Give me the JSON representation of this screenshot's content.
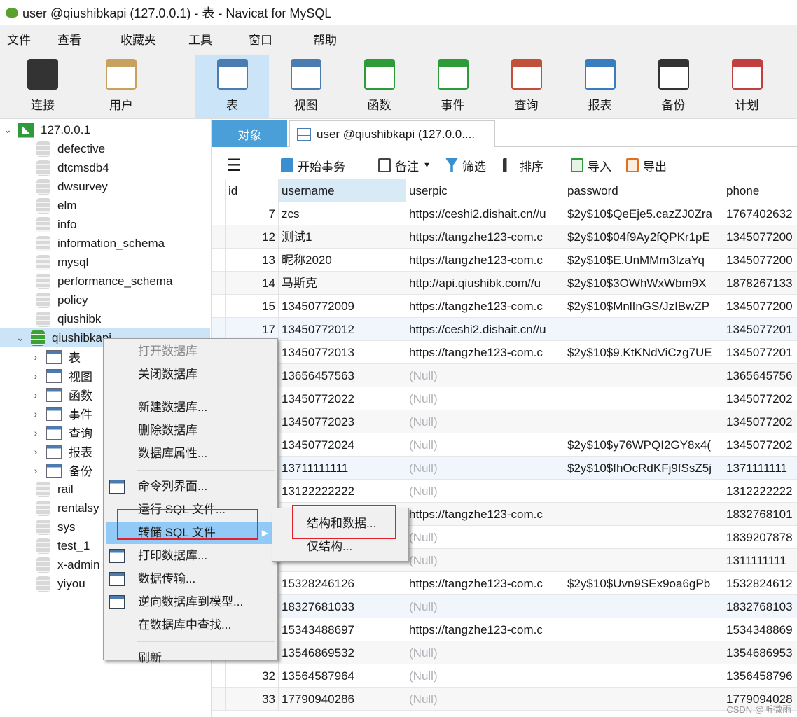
{
  "window": {
    "title": "user @qiushibkapi (127.0.0.1) - 表 - Navicat for MySQL"
  },
  "menubar": [
    "文件",
    "查看",
    "收藏夹",
    "工具",
    "窗口",
    "帮助"
  ],
  "toolbar": [
    {
      "label": "连接",
      "icon": "connection-icon"
    },
    {
      "label": "用户",
      "icon": "user-icon"
    },
    {
      "label": "表",
      "icon": "table-icon",
      "active": true
    },
    {
      "label": "视图",
      "icon": "view-icon"
    },
    {
      "label": "函数",
      "icon": "function-icon"
    },
    {
      "label": "事件",
      "icon": "event-icon"
    },
    {
      "label": "查询",
      "icon": "query-icon"
    },
    {
      "label": "报表",
      "icon": "report-icon"
    },
    {
      "label": "备份",
      "icon": "backup-icon"
    },
    {
      "label": "计划",
      "icon": "schedule-icon"
    }
  ],
  "sidebar": {
    "connection": "127.0.0.1",
    "databases": [
      "defective",
      "dtcmsdb4",
      "dwsurvey",
      "elm",
      "info",
      "information_schema",
      "mysql",
      "performance_schema",
      "policy",
      "qiushibk",
      "qiushibkapi",
      "rail",
      "rentalsy",
      "sys",
      "test_1",
      "x-admin",
      "yiyou"
    ],
    "selected": "qiushibkapi",
    "children": [
      {
        "label": "表",
        "icon": "table-icon"
      },
      {
        "label": "视图",
        "icon": "view-icon"
      },
      {
        "label": "函数",
        "icon": "function-icon"
      },
      {
        "label": "事件",
        "icon": "event-icon"
      },
      {
        "label": "查询",
        "icon": "query-icon"
      },
      {
        "label": "报表",
        "icon": "report-icon"
      },
      {
        "label": "备份",
        "icon": "backup-icon"
      }
    ]
  },
  "tabs": {
    "objects": "对象",
    "user_tab": "user @qiushibkapi (127.0.0...."
  },
  "gridbar": {
    "begin_tx": "开始事务",
    "memo": "备注",
    "filter": "筛选",
    "sort": "排序",
    "import": "导入",
    "export": "导出"
  },
  "grid": {
    "columns": [
      "id",
      "username",
      "userpic",
      "password",
      "phone"
    ],
    "rows": [
      [
        "7",
        "zcs",
        "https://ceshi2.dishait.cn//u",
        "$2y$10$QeEje5.cazZJ0Zra",
        "1767402632"
      ],
      [
        "12",
        "测试1",
        "https://tangzhe123-com.c",
        "$2y$10$04f9Ay2fQPKr1pE",
        "1345077200"
      ],
      [
        "13",
        "昵称2020",
        "https://tangzhe123-com.c",
        "$2y$10$E.UnMMm3lzaYq",
        "1345077200"
      ],
      [
        "14",
        "马斯克",
        "http://api.qiushibk.com//u",
        "$2y$10$3OWhWxWbm9X",
        "1878267133"
      ],
      [
        "15",
        "13450772009",
        "https://tangzhe123-com.c",
        "$2y$10$MnlInGS/JzIBwZP",
        "1345077200"
      ],
      [
        "17",
        "13450772012",
        "https://ceshi2.dishait.cn//u",
        "",
        "1345077201"
      ],
      [
        "",
        "13450772013",
        "https://tangzhe123-com.c",
        "$2y$10$9.KtKNdViCzg7UE",
        "1345077201"
      ],
      [
        "",
        "13656457563",
        "(Null)",
        "",
        "1365645756"
      ],
      [
        "",
        "13450772022",
        "(Null)",
        "",
        "1345077202"
      ],
      [
        "",
        "13450772023",
        "(Null)",
        "",
        "1345077202"
      ],
      [
        "",
        "13450772024",
        "(Null)",
        "$2y$10$y76WPQI2GY8x4(",
        "1345077202"
      ],
      [
        "",
        "13711111111",
        "(Null)",
        "$2y$10$fhOcRdKFj9fSsZ5j",
        "1371111111"
      ],
      [
        "",
        "13122222222",
        "(Null)",
        "",
        "1312222222"
      ],
      [
        "",
        "",
        "https://tangzhe123-com.c",
        "",
        "1832768101"
      ],
      [
        "",
        "",
        "(Null)",
        "",
        "1839207878"
      ],
      [
        "",
        "",
        "(Null)",
        "",
        "1311111111"
      ],
      [
        "",
        "15328246126",
        "https://tangzhe123-com.c",
        "$2y$10$Uvn9SEx9oa6gPb",
        "1532824612"
      ],
      [
        "",
        "18327681033",
        "(Null)",
        "",
        "1832768103"
      ],
      [
        "",
        "15343488697",
        "https://tangzhe123-com.c",
        "",
        "1534348869"
      ],
      [
        "",
        "13546869532",
        "(Null)",
        "",
        "1354686953"
      ],
      [
        "32",
        "13564587964",
        "(Null)",
        "",
        "1356458796"
      ],
      [
        "33",
        "17790940286",
        "(Null)",
        "",
        "1779094028"
      ]
    ]
  },
  "context_menu": [
    {
      "label": "打开数据库",
      "disabled": true
    },
    {
      "label": "关闭数据库"
    },
    {
      "sep": true
    },
    {
      "label": "新建数据库..."
    },
    {
      "label": "删除数据库"
    },
    {
      "label": "数据库属性..."
    },
    {
      "sep": true
    },
    {
      "label": "命令列界面...",
      "icon": "console-icon"
    },
    {
      "label": "运行 SQL 文件..."
    },
    {
      "label": "转储 SQL 文件",
      "highlighted": true,
      "submenu": true
    },
    {
      "label": "打印数据库...",
      "icon": "printer-icon"
    },
    {
      "label": "数据传输...",
      "icon": "data-transfer-icon"
    },
    {
      "label": "逆向数据库到模型...",
      "icon": "reverse-model-icon"
    },
    {
      "label": "在数据库中查找..."
    },
    {
      "sep": true
    },
    {
      "label": "刷新"
    }
  ],
  "submenu": [
    "结构和数据...",
    "仅结构..."
  ],
  "watermark": "CSDN @听微雨",
  "colors": {
    "accent": "#4a9fd8",
    "highlight": "#91c9f7",
    "annotation": "#e0202a"
  }
}
